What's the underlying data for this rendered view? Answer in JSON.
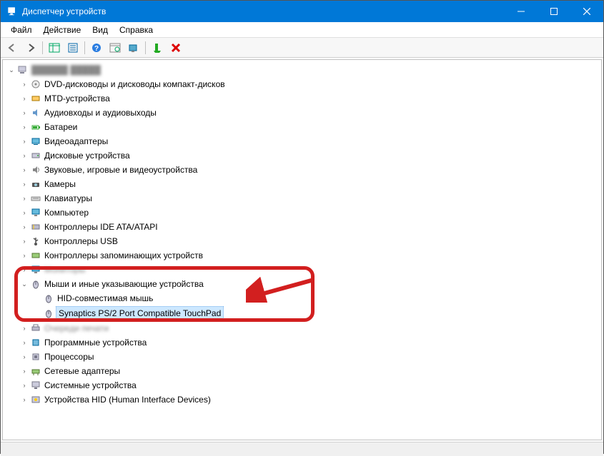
{
  "window": {
    "title": "Диспетчер устройств"
  },
  "menubar": {
    "file": "Файл",
    "action": "Действие",
    "view": "Вид",
    "help": "Справка"
  },
  "tree": {
    "root": "██████ █████",
    "items": {
      "dvd": "DVD-дисководы и дисководы компакт-дисков",
      "mtd": "MTD-устройства",
      "audio": "Аудиовходы и аудиовыходы",
      "battery": "Батареи",
      "video": "Видеоадаптеры",
      "disk": "Дисковые устройства",
      "sound": "Звуковые, игровые и видеоустройства",
      "camera": "Камеры",
      "keyboard": "Клавиатуры",
      "computer": "Компьютер",
      "ide": "Контроллеры IDE ATA/ATAPI",
      "usb": "Контроллеры USB",
      "storage": "Контроллеры запоминающих устройств",
      "monitor": "Мониторы",
      "mouse": "Мыши и иные указывающие устройства",
      "mouse_child1": "HID-совместимая мышь",
      "mouse_child2": "Synaptics PS/2 Port Compatible TouchPad",
      "print": "Очереди печати",
      "software": "Программные устройства",
      "cpu": "Процессоры",
      "network": "Сетевые адаптеры",
      "system": "Системные устройства",
      "hid": "Устройства HID (Human Interface Devices)"
    }
  }
}
